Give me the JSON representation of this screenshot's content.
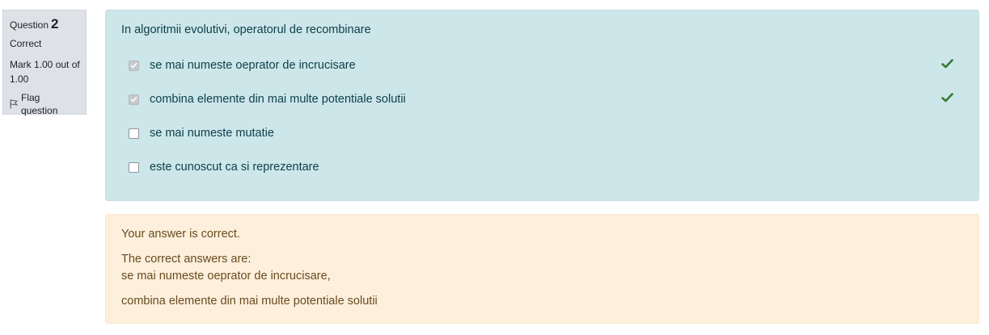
{
  "info": {
    "question_label": "Question",
    "question_number": "2",
    "state": "Correct",
    "grade": "Mark 1.00 out of 1.00",
    "flag_label": "Flag question",
    "flag_icon": "flag-outline-icon"
  },
  "question": {
    "text": "In algoritmii evolutivi, operatorul de recombinare",
    "answers": [
      {
        "label": "se mai numeste oeprator de incrucisare",
        "checked": true,
        "marked_correct": true
      },
      {
        "label": "combina elemente din mai multe potentiale solutii",
        "checked": true,
        "marked_correct": true
      },
      {
        "label": "se mai numeste mutatie",
        "checked": false,
        "marked_correct": false
      },
      {
        "label": "este cunoscut ca si reprezentare",
        "checked": false,
        "marked_correct": false
      }
    ],
    "correct_icon": "check-icon"
  },
  "feedback": {
    "summary": "Your answer is correct.",
    "heading": "The correct answers are:",
    "answers": [
      "se mai numeste oeprator de incrucisare,",
      "combina elemente din mai multe potentiale solutii"
    ]
  },
  "colors": {
    "question_panel_bg": "#cce6e9",
    "feedback_panel_bg": "#fcefdc",
    "info_bg": "#dee2e6",
    "check_green": "#357a32"
  }
}
